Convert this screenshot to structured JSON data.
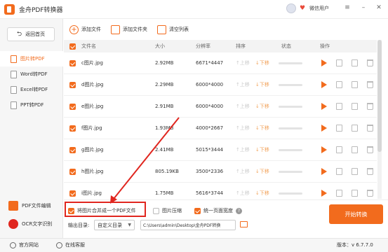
{
  "app": {
    "title": "金舟PDF转换器",
    "user_name": "微信用户",
    "version": "版本：v 6.7.7.0"
  },
  "sidebar": {
    "back_label": "返回首页",
    "items": [
      {
        "label": "图片转PDF",
        "active": true
      },
      {
        "label": "Word转PDF",
        "active": false
      },
      {
        "label": "Excel转PDF",
        "active": false
      },
      {
        "label": "PPT转PDF",
        "active": false
      }
    ],
    "bottom_items": [
      {
        "label": "PDF文件编辑",
        "icon": "pdf-edit-icon",
        "color": "#f26b1d"
      },
      {
        "label": "OCR文字识别",
        "icon": "ocr-icon",
        "color": "#e0261f"
      }
    ]
  },
  "toolbar": {
    "add_file": "添加文件",
    "add_folder": "添加文件夹",
    "clear_list": "清空列表"
  },
  "table": {
    "headers": {
      "name": "文件名",
      "size": "大小",
      "resolution": "分辨率",
      "order": "排序",
      "status": "状态",
      "actions": "操作"
    },
    "up_label": "↑上移",
    "down_label": "↓下移",
    "rows": [
      {
        "name": "c图片.jpg",
        "size": "2.92MB",
        "resolution": "6671*4447"
      },
      {
        "name": "d图片.jpg",
        "size": "2.29MB",
        "resolution": "6000*4000"
      },
      {
        "name": "e图片.jpg",
        "size": "2.91MB",
        "resolution": "6000*4000"
      },
      {
        "name": "f图片.jpg",
        "size": "1.93MB",
        "resolution": "4000*2667"
      },
      {
        "name": "g图片.jpg",
        "size": "2.41MB",
        "resolution": "5015*3444"
      },
      {
        "name": "h图片.jpg",
        "size": "805.19KB",
        "resolution": "3500*2336"
      },
      {
        "name": "i图片.jpg",
        "size": "1.75MB",
        "resolution": "5616*3744"
      }
    ]
  },
  "options": {
    "merge_label": "将图片合并成一个PDF文件",
    "merge_checked": true,
    "compress_label": "图片压缩",
    "compress_checked": false,
    "uniform_label": "统一页面宽度",
    "uniform_checked": true
  },
  "output": {
    "label": "输出目录:",
    "mode": "自定义目录",
    "path": "C:\\Users\\admin\\Desktop\\金舟PDF转换"
  },
  "start_button": "开始转换",
  "statusbar": {
    "website": "官方网站",
    "service": "在线客服"
  },
  "colors": {
    "accent": "#f26b1d",
    "highlight": "#e0261f"
  }
}
